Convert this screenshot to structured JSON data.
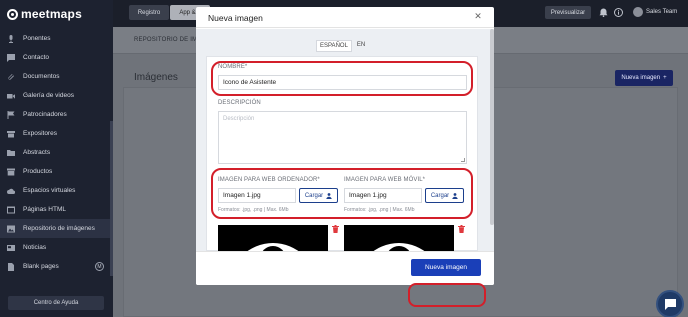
{
  "app": {
    "logo_text": "meetmaps"
  },
  "sidebar": {
    "items": [
      {
        "label": "Ponentes",
        "icon": "mic-icon"
      },
      {
        "label": "Contacto",
        "icon": "chat-icon"
      },
      {
        "label": "Documentos",
        "icon": "paperclip-icon"
      },
      {
        "label": "Galería de videos",
        "icon": "video-icon"
      },
      {
        "label": "Patrocinadores",
        "icon": "flag-icon"
      },
      {
        "label": "Expositores",
        "icon": "store-icon"
      },
      {
        "label": "Abstracts",
        "icon": "folder-icon"
      },
      {
        "label": "Productos",
        "icon": "box-icon"
      },
      {
        "label": "Espacios virtuales",
        "icon": "cloud-icon"
      },
      {
        "label": "Páginas HTML",
        "icon": "code-icon"
      },
      {
        "label": "Repositorio de imágenes",
        "icon": "image-icon",
        "active": true
      },
      {
        "label": "Noticias",
        "icon": "news-icon"
      },
      {
        "label": "Blank pages",
        "icon": "page-icon",
        "badge": "M"
      }
    ],
    "help_label": "Centro de Ayuda"
  },
  "topbar": {
    "tabs": [
      "Registro",
      "App & L"
    ],
    "preview_label": "Previsualizar",
    "user_name": "Sales Team"
  },
  "main": {
    "sub_tab": "REPOSITORIO DE IMÁG",
    "page_title": "Imágenes",
    "new_image_button": "Nueva imagen"
  },
  "modal": {
    "title": "Nueva imagen",
    "languages": [
      "ESPAÑOL",
      "EN"
    ],
    "active_language": "ESPAÑOL",
    "name_label": "NOMBRE*",
    "name_value": "Icono de Asistente",
    "description_label": "DESCRIPCIÓN",
    "description_placeholder": "Descripción",
    "desktop_label": "IMAGEN PARA WEB ORDENADOR*",
    "desktop_file": "Imagen 1.jpg",
    "mobile_label": "IMAGEN PARA WEB MÓVIL*",
    "mobile_file": "Imagen 1.jpg",
    "upload_label": "Cargar",
    "format_hint": "Formatos: .jpg, .png | Max. 6Mb",
    "submit_label": "Nueva imagen"
  },
  "colors": {
    "sidebar_bg": "#1d2230",
    "primary": "#1a3fb8",
    "highlight": "#d31f2a",
    "danger": "#e0393e"
  }
}
